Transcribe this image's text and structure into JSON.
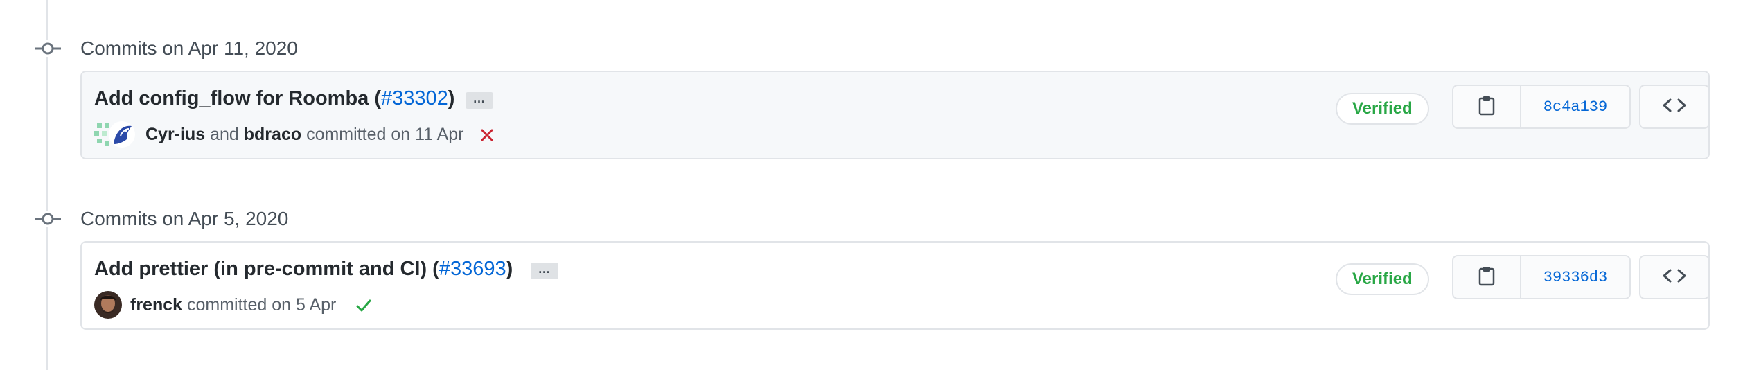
{
  "groups": [
    {
      "title": "Commits on Apr 11, 2020",
      "commit": {
        "message": "Add config_flow for Roomba (",
        "pr_link": "#33302",
        "message_end": ")",
        "ellipsis": "…",
        "authors": [
          "Cyr-ius",
          "bdraco"
        ],
        "joiner": "and",
        "committed_text": "committed on 11 Apr",
        "status": "failure",
        "verified_label": "Verified",
        "sha": "8c4a139"
      }
    },
    {
      "title": "Commits on Apr 5, 2020",
      "commit": {
        "message": "Add prettier (in pre-commit and CI) (",
        "pr_link": "#33693",
        "message_end": ")",
        "ellipsis": "…",
        "authors": [
          "frenck"
        ],
        "committed_text": "committed on 5 Apr",
        "status": "success",
        "verified_label": "Verified",
        "sha": "39336d3"
      }
    }
  ],
  "colors": {
    "link": "#0366d6",
    "verified": "#28a745",
    "failure": "#cb2431",
    "success": "#28a745",
    "border": "#e1e4e8"
  },
  "icons": {
    "timeline_node": "git-commit-icon",
    "copy": "clipboard-icon",
    "browse": "code-icon",
    "failure": "x-icon",
    "success": "check-icon"
  }
}
